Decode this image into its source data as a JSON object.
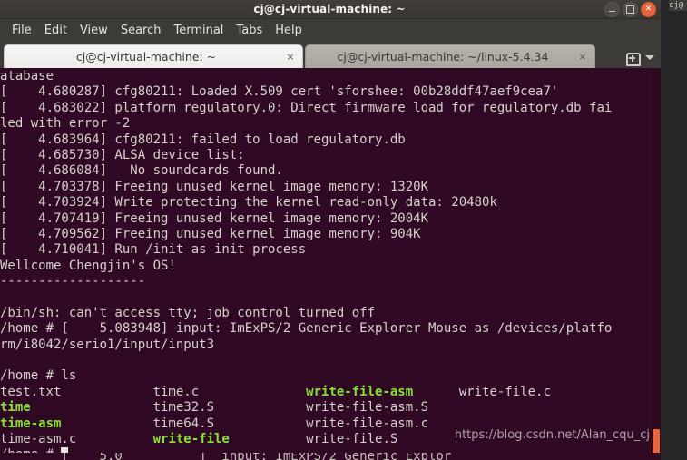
{
  "window": {
    "title": "cj@cj-virtual-machine: ~",
    "buttons": {
      "minimize": "minimize-button",
      "maximize": "maximize-button",
      "close_label": "✕"
    }
  },
  "menubar": {
    "items": [
      {
        "label": "File"
      },
      {
        "label": "Edit"
      },
      {
        "label": "View"
      },
      {
        "label": "Search"
      },
      {
        "label": "Terminal"
      },
      {
        "label": "Tabs"
      },
      {
        "label": "Help"
      }
    ]
  },
  "tabs": {
    "items": [
      {
        "label": "cj@cj-virtual-machine: ~",
        "close_label": "×",
        "active": true
      },
      {
        "label": "cj@cj-virtual-machine: ~/linux-5.4.34",
        "close_label": "×",
        "active": false
      }
    ],
    "new_tab_label": "New Tab",
    "menu_label": "Tab list"
  },
  "terminal": {
    "colors": {
      "background": "#300a24",
      "foreground": "#d6d0cc",
      "green_bold": "#8ae234",
      "cursor": "#e8e4e0",
      "scrollbar_thumb": "#e8663d"
    },
    "lines": [
      "atabase",
      "[    4.680287] cfg80211: Loaded X.509 cert 'sforshee: 00b28ddf47aef9cea7'",
      "[    4.683022] platform regulatory.0: Direct firmware load for regulatory.db fai",
      "led with error -2",
      "[    4.683964] cfg80211: failed to load regulatory.db",
      "[    4.685730] ALSA device list:",
      "[    4.686084]   No soundcards found.",
      "[    4.703378] Freeing unused kernel image memory: 1320K",
      "[    4.703924] Write protecting the kernel read-only data: 20480k",
      "[    4.707419] Freeing unused kernel image memory: 2004K",
      "[    4.709562] Freeing unused kernel image memory: 904K",
      "[    4.710041] Run /init as init process",
      "Wellcome Chengjin's OS!",
      "-------------------",
      "",
      "/bin/sh: can't access tty; job control turned off",
      "/home # [    5.083948] input: ImExPS/2 Generic Explorer Mouse as /devices/platfo",
      "rm/i8042/serio1/input/input3",
      "",
      "/home # ls"
    ],
    "ls_output": {
      "rows": [
        [
          {
            "text": "test.txt",
            "color": "white"
          },
          {
            "text": "time.c",
            "color": "white"
          },
          {
            "text": "write-file-asm",
            "color": "green"
          },
          {
            "text": "write-file.c",
            "color": "white"
          }
        ],
        [
          {
            "text": "time",
            "color": "green"
          },
          {
            "text": "time32.S",
            "color": "white"
          },
          {
            "text": "write-file-asm.S",
            "color": "white"
          },
          {
            "text": "",
            "color": "white"
          }
        ],
        [
          {
            "text": "time-asm",
            "color": "green"
          },
          {
            "text": "time64.S",
            "color": "white"
          },
          {
            "text": "write-file-asm.c",
            "color": "white"
          },
          {
            "text": "",
            "color": "white"
          }
        ],
        [
          {
            "text": "time-asm.c",
            "color": "white"
          },
          {
            "text": "write-file",
            "color": "green"
          },
          {
            "text": "write-file.S",
            "color": "white"
          },
          {
            "text": "",
            "color": "white"
          }
        ]
      ]
    },
    "prompt": "/home # ",
    "cursor_visible": true
  },
  "background_window": {
    "bottom_strip_text": "        [    5.0          ]  input: ImExPS/2 Generic Explor",
    "topright_text": "cj@"
  },
  "watermark": {
    "text": "https://blog.csdn.net/Alan_cqu_cj"
  }
}
